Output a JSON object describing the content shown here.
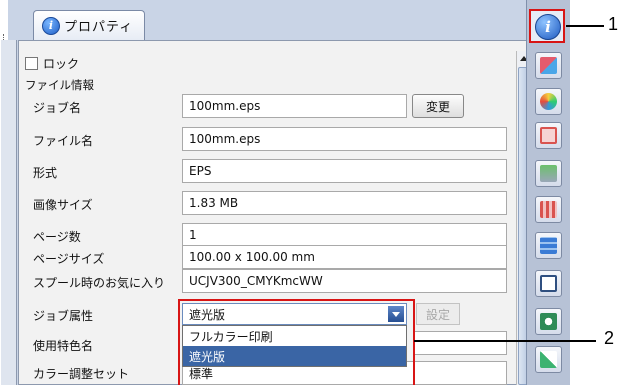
{
  "tab": {
    "label": "プロパティ",
    "icon": "properties-icon"
  },
  "lock": {
    "label": "ロック",
    "checked": false
  },
  "section_title": "ファイル情報",
  "fields": {
    "job_name": {
      "label": "ジョブ名",
      "value": "100mm.eps"
    },
    "file_name": {
      "label": "ファイル名",
      "value": "100mm.eps"
    },
    "format": {
      "label": "形式",
      "value": "EPS"
    },
    "image_size": {
      "label": "画像サイズ",
      "value": "1.83 MB"
    },
    "page_count": {
      "label": "ページ数",
      "value": "1"
    },
    "page_size": {
      "label": "ページサイズ",
      "value": "100.00 x 100.00 mm"
    },
    "spool_favorite": {
      "label": "スプール時のお気に入り",
      "value": "UCJV300_CMYKmcWW"
    },
    "job_attribute": {
      "label": "ジョブ属性",
      "value": "遮光版"
    },
    "spot_color": {
      "label": "使用特色名",
      "value": ""
    },
    "color_adjust_set": {
      "label": "カラー調整セット",
      "value": "標準"
    }
  },
  "buttons": {
    "change": "変更",
    "settings": "設定"
  },
  "job_attribute_options": [
    "フルカラー印刷",
    "遮光版"
  ],
  "selected_option_index": 1,
  "callouts": {
    "one": "1",
    "two": "2"
  },
  "sidebar_icons": [
    "info-icon",
    "layout-icon",
    "quality-icon",
    "frame-icon",
    "print-icon",
    "cut-icon",
    "tile-icon",
    "preview-icon",
    "variable-icon",
    "layer-icon"
  ],
  "colors": {
    "callout_red": "#d81515",
    "selected_blue": "#3a65a5"
  }
}
